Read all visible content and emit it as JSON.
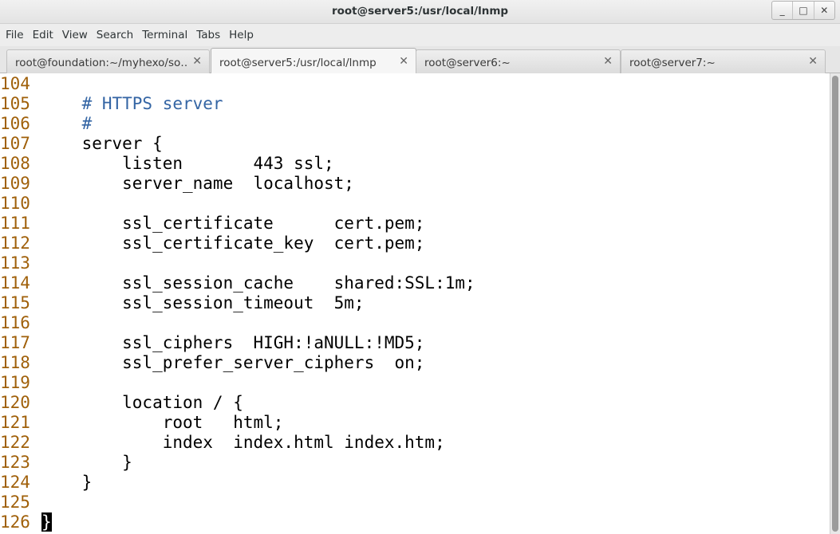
{
  "window": {
    "title": "root@server5:/usr/local/lnmp",
    "minimize_glyph": "_",
    "maximize_glyph": "□",
    "close_glyph": "✕"
  },
  "menu": [
    "File",
    "Edit",
    "View",
    "Search",
    "Terminal",
    "Tabs",
    "Help"
  ],
  "tabs": [
    {
      "label": "root@foundation:~/myhexo/so…",
      "active": false
    },
    {
      "label": "root@server5:/usr/local/lnmp",
      "active": true
    },
    {
      "label": "root@server6:~",
      "active": false
    },
    {
      "label": "root@server7:~",
      "active": false
    }
  ],
  "tab_close_glyph": "✕",
  "editor": {
    "lines": [
      {
        "n": "104",
        "code": ""
      },
      {
        "n": "105",
        "code": "    # HTTPS server",
        "comment": true
      },
      {
        "n": "106",
        "code": "    #",
        "comment": true
      },
      {
        "n": "107",
        "code": "    server {"
      },
      {
        "n": "108",
        "code": "        listen       443 ssl;"
      },
      {
        "n": "109",
        "code": "        server_name  localhost;"
      },
      {
        "n": "110",
        "code": ""
      },
      {
        "n": "111",
        "code": "        ssl_certificate      cert.pem;"
      },
      {
        "n": "112",
        "code": "        ssl_certificate_key  cert.pem;"
      },
      {
        "n": "113",
        "code": ""
      },
      {
        "n": "114",
        "code": "        ssl_session_cache    shared:SSL:1m;"
      },
      {
        "n": "115",
        "code": "        ssl_session_timeout  5m;"
      },
      {
        "n": "116",
        "code": ""
      },
      {
        "n": "117",
        "code": "        ssl_ciphers  HIGH:!aNULL:!MD5;"
      },
      {
        "n": "118",
        "code": "        ssl_prefer_server_ciphers  on;"
      },
      {
        "n": "119",
        "code": ""
      },
      {
        "n": "120",
        "code": "        location / {"
      },
      {
        "n": "121",
        "code": "            root   html;"
      },
      {
        "n": "122",
        "code": "            index  index.html index.htm;"
      },
      {
        "n": "123",
        "code": "        }"
      },
      {
        "n": "124",
        "code": "    }"
      },
      {
        "n": "125",
        "code": ""
      },
      {
        "n": "126",
        "code": "",
        "cursor": "}"
      }
    ]
  },
  "colors": {
    "line_number": "#a0600a",
    "comment": "#3465a4",
    "text": "#000000"
  }
}
